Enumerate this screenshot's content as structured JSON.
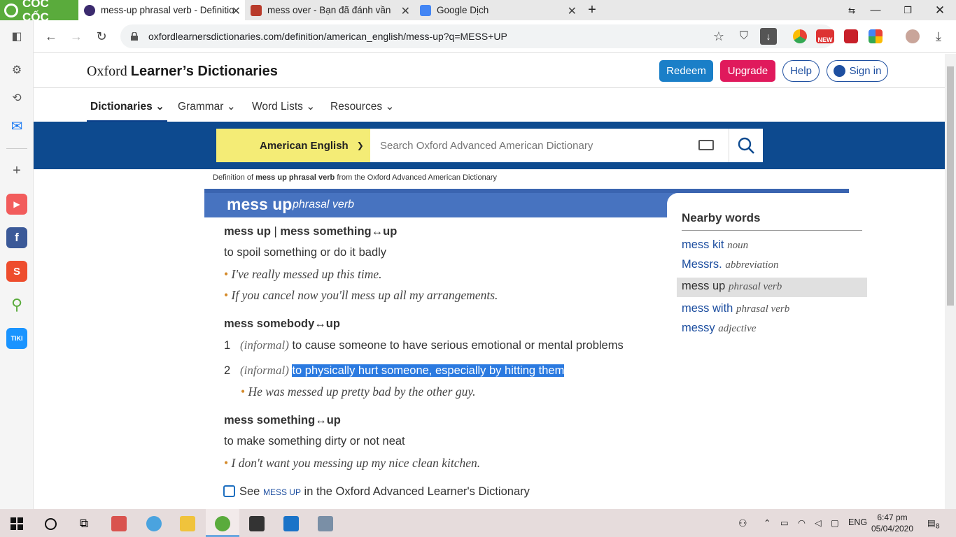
{
  "browser": {
    "brand": "CỐC CỐC",
    "tabs": [
      {
        "title": "mess-up phrasal verb - Definition",
        "color": "#3b2a6e"
      },
      {
        "title": "mess over - Bạn đã đánh vần",
        "color": "#b83a2a"
      },
      {
        "title": "Google Dịch",
        "color": "#4285f4"
      }
    ],
    "url": "oxfordlearnersdictionaries.com/definition/american_english/mess-up?q=MESS+UP",
    "extension_badge": "NEW"
  },
  "site": {
    "logo_plain": "Oxford ",
    "logo_bold": "Learner’s Dictionaries",
    "buttons": {
      "redeem": "Redeem",
      "upgrade": "Upgrade",
      "help": "Help",
      "signin": "Sign in"
    },
    "nav": [
      "Dictionaries",
      "Grammar",
      "Word Lists",
      "Resources"
    ],
    "dictionary_select": "American English",
    "search_placeholder": "Search Oxford Advanced American Dictionary"
  },
  "entry": {
    "breadcrumb_pre": "Definition of ",
    "breadcrumb_bold": "mess up phrasal verb",
    "breadcrumb_post": " from the Oxford Advanced American Dictionary",
    "headword": "mess up",
    "pos": "phrasal verb",
    "sense1": {
      "phrase_a": "mess up",
      "separator": " | ",
      "phrase_b": "mess something↔up",
      "def": "to spoil something or do it badly",
      "examples": [
        "I've really messed up this time.",
        "If you cancel now you'll mess up all my arrangements."
      ]
    },
    "sense2": {
      "phrase": "mess somebody↔up",
      "items": [
        {
          "num": "1",
          "label": "informal",
          "def": "to cause someone to have serious emotional or mental problems"
        },
        {
          "num": "2",
          "label": "informal",
          "def": "to physically hurt someone, especially by hitting them",
          "example": "He was messed up pretty bad by the other guy."
        }
      ]
    },
    "sense3": {
      "phrase": "mess something↔up",
      "def": "to make something dirty or not neat",
      "example": "I don't want you messing up my nice clean kitchen."
    },
    "see_also": {
      "pre": "See ",
      "link": "mess up",
      "post": " in the Oxford Advanced Learner's Dictionary"
    }
  },
  "nearby": {
    "title": "Nearby words",
    "items": [
      {
        "word": "mess kit",
        "pos": "noun"
      },
      {
        "word": "Messrs.",
        "pos": "abbreviation"
      },
      {
        "word": "mess up",
        "pos": "phrasal verb"
      },
      {
        "word": "mess with",
        "pos": "phrasal verb"
      },
      {
        "word": "messy",
        "pos": "adjective"
      }
    ]
  },
  "taskbar": {
    "lang": "ENG",
    "time": "6:47 pm",
    "date": "05/04/2020",
    "notification_count": "8"
  },
  "colors": {
    "accent_blue": "#0d4a8f",
    "upgrade_pink": "#e0195c",
    "redeem_blue": "#1a7fc8",
    "highlight": "#2b7ae0"
  }
}
